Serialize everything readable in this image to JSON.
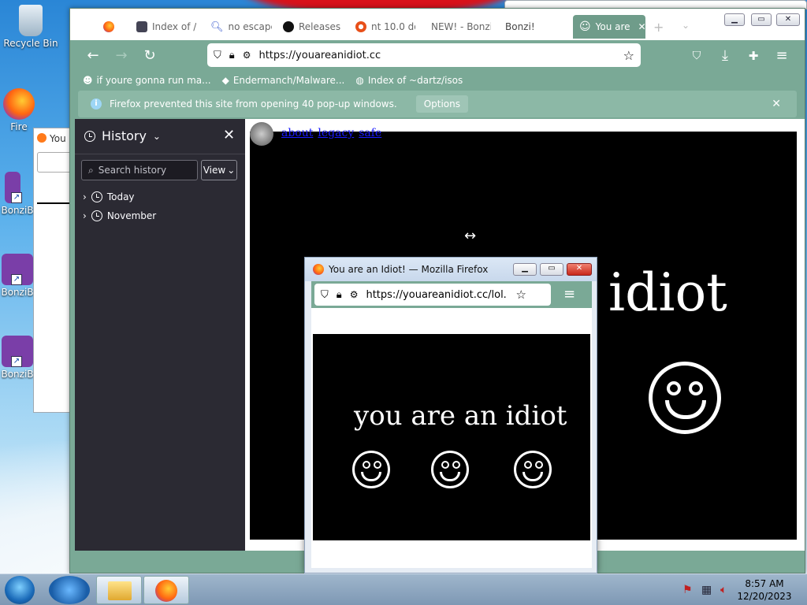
{
  "desktop": {
    "icons": [
      {
        "label": "Recycle Bin"
      },
      {
        "label": "Fire"
      },
      {
        "label": "BonziB"
      },
      {
        "label": "BonziB"
      },
      {
        "label": "BonziB"
      }
    ],
    "bg_tab_label": "You"
  },
  "browser": {
    "tabs": [
      {
        "label": ""
      },
      {
        "label": "Index of /"
      },
      {
        "label": "no escape"
      },
      {
        "label": "Releases"
      },
      {
        "label": "nt 10.0 do"
      },
      {
        "label": "NEW! - Bonzi"
      },
      {
        "label": "Bonzi!"
      },
      {
        "label": "You are"
      }
    ],
    "url": "https://youareanidiot.cc",
    "bookmarks": [
      {
        "label": "if youre gonna run ma..."
      },
      {
        "label": "Endermanch/Malware..."
      },
      {
        "label": "Index of ~dartz/isos"
      }
    ],
    "notification": {
      "text": "Firefox prevented this site from opening 40 pop-up windows.",
      "button": "Options"
    },
    "sidebar": {
      "title": "History",
      "search_placeholder": "Search history",
      "view_label": "View",
      "groups": [
        {
          "label": "Today"
        },
        {
          "label": "November"
        }
      ]
    },
    "page": {
      "links": [
        "about",
        "legacy",
        "safe"
      ],
      "big_word": "idiot"
    }
  },
  "popup": {
    "title": "You are an Idiot! — Mozilla Firefox",
    "url": "https://youareanidiot.cc/lol.",
    "message": "you are an idiot"
  },
  "taskbar": {
    "time": "8:57 AM",
    "date": "12/20/2023"
  },
  "colors": {
    "toolbar": "#7aa996",
    "sidebar": "#2b2a33",
    "page_bg": "#000000"
  }
}
